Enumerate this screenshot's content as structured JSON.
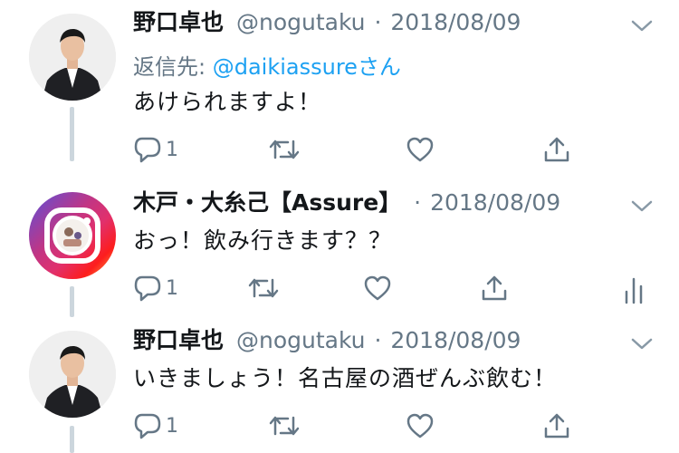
{
  "tweets": [
    {
      "name": "野口卓也",
      "handle": "@nogutaku",
      "separator": "·",
      "date": "2018/08/09",
      "reply_prefix": "返信先: ",
      "reply_handle": "@daikiassure",
      "reply_suffix": "さん",
      "text": "あけられますよ！",
      "reply_count": "1"
    },
    {
      "name": "木戸・大糸己【Assure】",
      "separator": "·",
      "date": "2018/08/09",
      "text": "おっ！飲み行きます？？",
      "reply_count": "1"
    },
    {
      "name": "野口卓也",
      "handle": "@nogutaku",
      "separator": "·",
      "date": "2018/08/09",
      "text": "いきましょう！名古屋の酒ぜんぶ飲む！",
      "reply_count": "1"
    }
  ],
  "colors": {
    "text": "#14171a",
    "muted": "#657786",
    "link": "#1da1f2",
    "thread": "#ccd6dd"
  },
  "icons": [
    "reply-icon",
    "retweet-icon",
    "like-icon",
    "share-icon",
    "analytics-icon",
    "caret-down-icon"
  ]
}
